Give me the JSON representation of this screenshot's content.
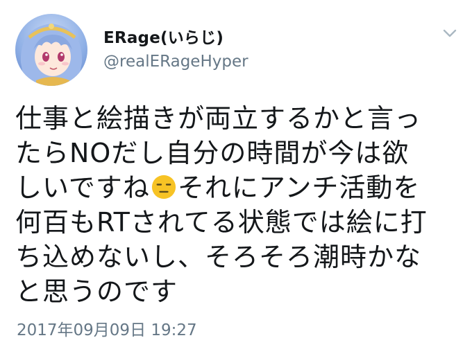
{
  "tweet": {
    "author": {
      "display_name": "ERage(いらじ)",
      "handle": "@realERageHyper",
      "avatar": "anime-character-avatar"
    },
    "text_lines": [
      "仕事と絵描きが両立するかと言っ",
      "たらNOだし自分の時間が今は欲",
      "しいですね",
      "それにアンチ活動を",
      "何百もRTされてる状態では絵に打",
      "ち込めないし、そろそろ潮時かな",
      "と思うのです"
    ],
    "emoji": "expressionless-face",
    "timestamp": "2017年09月09日 19:27"
  },
  "icons": {
    "menu": "chevron-down-icon"
  },
  "colors": {
    "text": "#14171a",
    "secondary": "#657786",
    "emoji_face": "#f7c325"
  }
}
